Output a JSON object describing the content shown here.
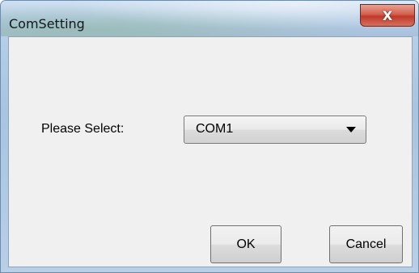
{
  "window": {
    "title": "ComSetting",
    "close_label": "X"
  },
  "form": {
    "select_label": "Please Select:",
    "port_selected": "COM1"
  },
  "buttons": {
    "ok_label": "OK",
    "cancel_label": "Cancel"
  },
  "colors": {
    "titlebar": "#b5cde6",
    "close_button": "#c0392b",
    "client_background": "#f0f0f0"
  }
}
